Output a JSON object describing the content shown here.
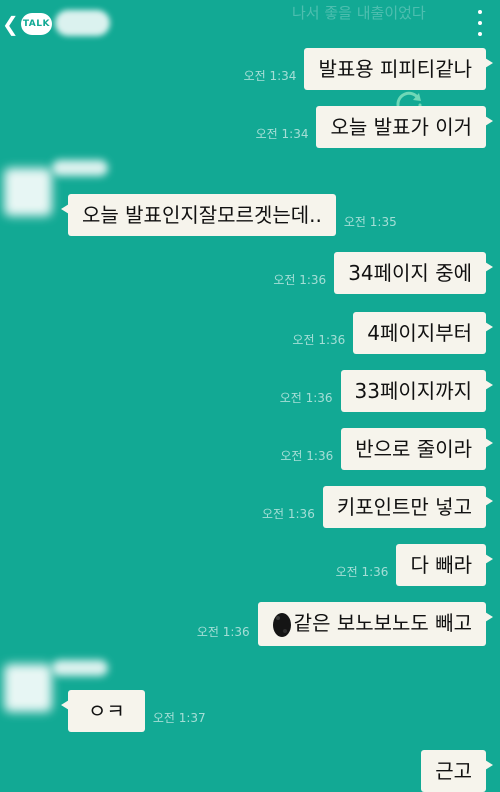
{
  "header": {
    "back_icon": "chevron-left",
    "back_badge": "TALK",
    "faint_title": "나서 좋을 내출이었다",
    "more_icon": "vertical-dots"
  },
  "colors": {
    "chat_bg": "#12a994",
    "bubble": "#f6f4ec",
    "text": "#111111",
    "timestamp": "#a3ddd4"
  },
  "messages": [
    {
      "side": "out",
      "text": "발표용 피피티같나",
      "time": "오전 1:34"
    },
    {
      "side": "out",
      "text": "오늘 발표가 이거",
      "time": "오전 1:34"
    },
    {
      "side": "in",
      "text": "오늘 발표인지잘모르겟는데..",
      "time": "오전 1:35"
    },
    {
      "side": "out",
      "text": "34페이지 중에",
      "time": "오전 1:36"
    },
    {
      "side": "out",
      "text": "4페이지부터",
      "time": "오전 1:36"
    },
    {
      "side": "out",
      "text": "33페이지까지",
      "time": "오전 1:36"
    },
    {
      "side": "out",
      "text": "반으로 줄이라",
      "time": "오전 1:36"
    },
    {
      "side": "out",
      "text": "키포인트만 넣고",
      "time": "오전 1:36"
    },
    {
      "side": "out",
      "text": "다 빼라",
      "time": "오전 1:36"
    },
    {
      "side": "out",
      "text": "같은 보노보노도 빼고",
      "time": "오전 1:36"
    },
    {
      "side": "in",
      "text": "ㅇㅋ",
      "time": "오전 1:37"
    },
    {
      "side": "out",
      "text": "근고",
      "time": ""
    }
  ]
}
